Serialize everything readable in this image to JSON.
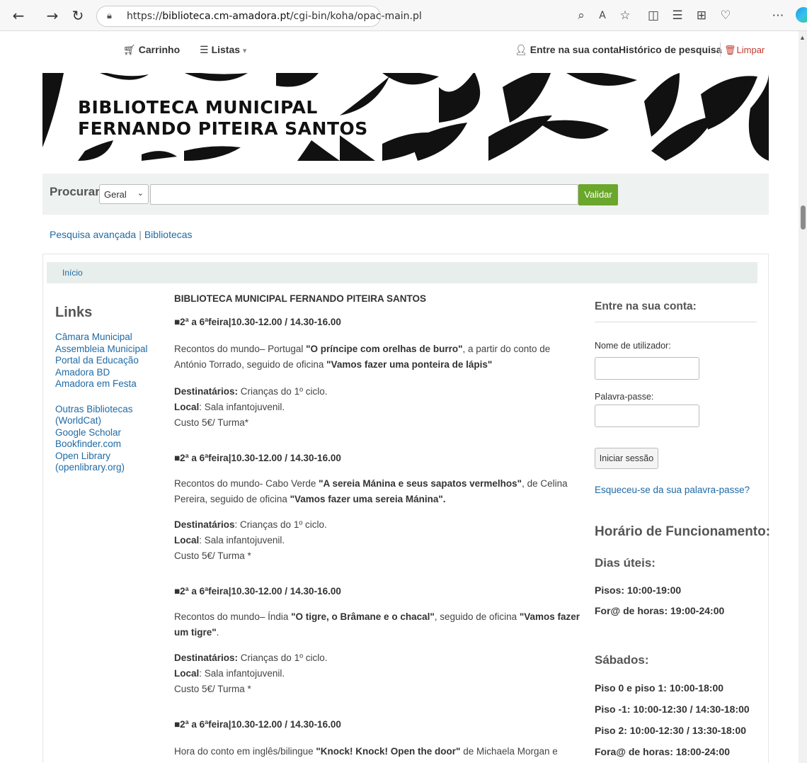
{
  "browser": {
    "url_prefix": "https://",
    "url_domain": "biblioteca.cm-amadora.pt",
    "url_path": "/cgi-bin/koha/opac-main.pl"
  },
  "topnav": {
    "cart": "Carrinho",
    "lists": "Listas",
    "login": "Entre na sua conta",
    "history": "Histórico de pesquisa",
    "clear": "Limpar"
  },
  "banner": {
    "line1": "BIBLIOTECA MUNICIPAL",
    "line2": "FERNANDO PITEIRA SANTOS"
  },
  "search": {
    "label": "Procurar",
    "scope": "Geral",
    "query": "",
    "submit": "Validar"
  },
  "sublinks": {
    "advanced": "Pesquisa avançada",
    "separator": "|",
    "libraries": "Bibliotecas"
  },
  "breadcrumb": "Início",
  "links": {
    "title": "Links",
    "group1": [
      "Câmara Municipal",
      "Assembleia Municipal",
      "Portal da Educação",
      "Amadora BD",
      "Amadora em Festa"
    ],
    "group2": [
      "Outras Bibliotecas (WorldCat)",
      "Google Scholar",
      "Bookfinder.com",
      "Open Library (openlibrary.org)"
    ]
  },
  "main": {
    "title": "BIBLIOTECA MUNICIPAL FERNANDO PITEIRA SANTOS",
    "events": [
      {
        "schedule": "■2ª a 6ªfeira|10.30-12.00 / 14.30-16.00",
        "desc_pre": "Recontos do mundo– Portugal ",
        "desc_b1": "\"O príncipe com orelhas de burro\"",
        "desc_mid": ", a partir do conto de António Torrado, seguido de oficina ",
        "desc_b2": "\"Vamos fazer uma ponteira de lápis\"",
        "desc_post": "",
        "aud_label": "Destinatários:",
        "aud": " Crianças do 1º ciclo.",
        "loc_label": "Local",
        "loc": ": Sala infantojuvenil.",
        "cost": "Custo 5€/ Turma*"
      },
      {
        "schedule": "■2ª a 6ªfeira|10.30-12.00 / 14.30-16.00",
        "desc_pre": "Recontos do mundo- Cabo Verde ",
        "desc_b1": "\"A sereia Mánina e seus sapatos vermelhos\"",
        "desc_mid": ", de Celina Pereira, seguido de oficina ",
        "desc_b2": "\"Vamos fazer uma sereia Mánina\".",
        "desc_post": "",
        "aud_label": "Destinatários",
        "aud": ": Crianças do 1º ciclo.",
        "loc_label": "Local",
        "loc": ": Sala infantojuvenil.",
        "cost": "Custo 5€/ Turma *"
      },
      {
        "schedule": "■2ª a 6ªfeira|10.30-12.00 / 14.30-16.00",
        "desc_pre": "Recontos do mundo– Índia ",
        "desc_b1": "\"O tigre, o Brâmane e o chacal\"",
        "desc_mid": ", seguido de oficina ",
        "desc_b2": "\"Vamos fazer um tigre\"",
        "desc_post": ".",
        "aud_label": "Destinatários:",
        "aud": " Crianças do 1º ciclo.",
        "loc_label": "Local",
        "loc": ": Sala infantojuvenil.",
        "cost": "Custo 5€/ Turma *"
      },
      {
        "schedule": "■2ª a 6ªfeira|10.30-12.00 / 14.30-16.00",
        "desc_pre": "Hora do conto em inglês/bilingue ",
        "desc_b1": "\"Knock! Knock! Open the door\"",
        "desc_mid": " de Michaela Morgan e David Walker.",
        "desc_b2": "",
        "desc_post": ""
      }
    ]
  },
  "login": {
    "title": "Entre na sua conta:",
    "username_label": "Nome de utilizador:",
    "password_label": "Palavra-passe:",
    "submit": "Iniciar sessão",
    "forgot": "Esqueceu-se da sua palavra-passe?"
  },
  "hours": {
    "title": "Horário de Funcionamento:",
    "weekdays_title": "Dias úteis:",
    "weekdays": [
      "Pisos: 10:00-19:00",
      "For@ de horas: 19:00-24:00"
    ],
    "saturdays_title": "Sábados:",
    "saturdays": [
      "Piso 0 e piso 1: 10:00-18:00",
      "Piso -1: 10:00-12:30 / 14:30-18:00",
      "Piso 2: 10:00-12:30 / 13:30-18:00",
      "Fora@ de horas: 18:00-24:00"
    ]
  },
  "icons": {
    "back": "back-arrow-icon",
    "forward": "forward-arrow-icon",
    "reload": "reload-icon",
    "cart": "cart-icon",
    "lists": "list-icon",
    "user": "user-icon",
    "trash": "trash-icon"
  },
  "colors": {
    "link": "#1f6aa5",
    "submit_green": "#6aa72b",
    "clear_red": "#c0392b"
  }
}
